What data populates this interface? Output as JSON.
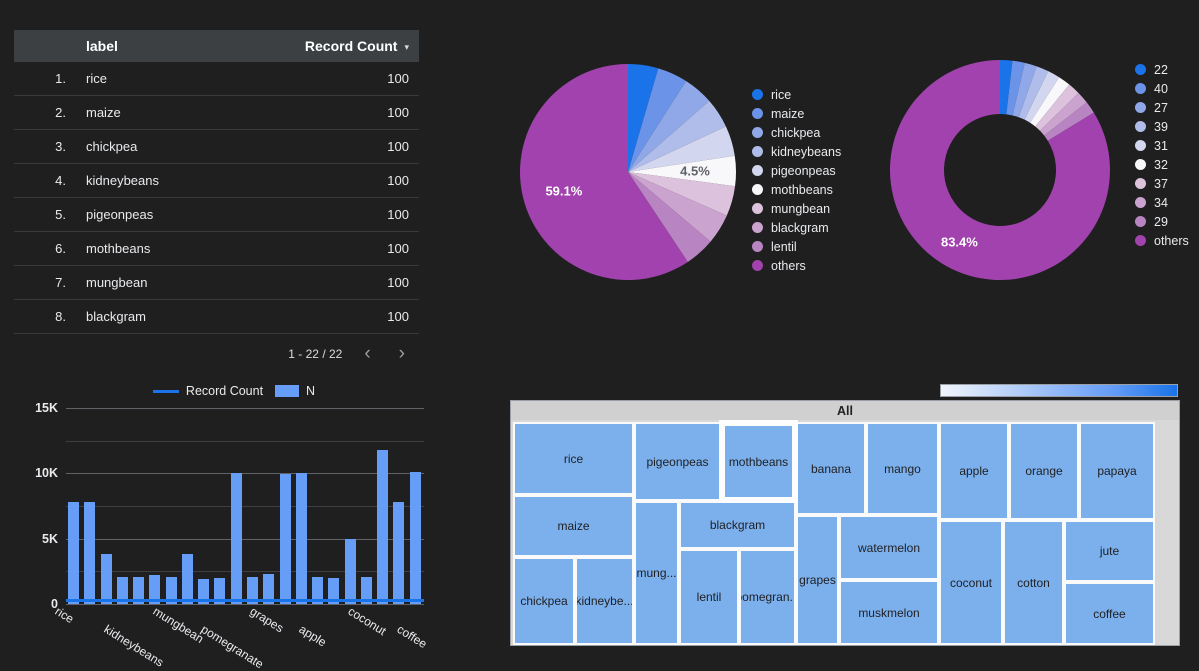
{
  "table": {
    "columns": {
      "index": "",
      "label": "label",
      "count": "Record Count"
    },
    "sort_caret": "▾",
    "rows": [
      {
        "idx": "1.",
        "label": "rice",
        "count": "100"
      },
      {
        "idx": "2.",
        "label": "maize",
        "count": "100"
      },
      {
        "idx": "3.",
        "label": "chickpea",
        "count": "100"
      },
      {
        "idx": "4.",
        "label": "kidneybeans",
        "count": "100"
      },
      {
        "idx": "5.",
        "label": "pigeonpeas",
        "count": "100"
      },
      {
        "idx": "6.",
        "label": "mothbeans",
        "count": "100"
      },
      {
        "idx": "7.",
        "label": "mungbean",
        "count": "100"
      },
      {
        "idx": "8.",
        "label": "blackgram",
        "count": "100"
      }
    ],
    "pager": {
      "range": "1 - 22 / 22",
      "prev": "‹",
      "next": "›"
    }
  },
  "chart_data": [
    {
      "type": "pie",
      "title": "",
      "categories": [
        "rice",
        "maize",
        "chickpea",
        "kidneybeans",
        "pigeonpeas",
        "mothbeans",
        "mungbean",
        "blackgram",
        "lentil",
        "others"
      ],
      "values": [
        4.5,
        4.5,
        4.5,
        4.5,
        4.5,
        4.5,
        4.5,
        4.5,
        4.5,
        59.1
      ],
      "value_unit": "%",
      "labels_shown": {
        "others": "59.1%",
        "mothbeans": "4.5%"
      },
      "colors": [
        "#1a73e8",
        "#6b93e8",
        "#90a8e8",
        "#b0bdea",
        "#d2d6ee",
        "#f8f8fa",
        "#ddc2dd",
        "#cba3cf",
        "#b885c2",
        "#a142ae"
      ],
      "legend_position": "right"
    },
    {
      "type": "pie",
      "variant": "donut",
      "title": "",
      "categories": [
        "22",
        "40",
        "27",
        "39",
        "31",
        "32",
        "37",
        "34",
        "29",
        "others"
      ],
      "values": [
        1.8,
        1.8,
        1.8,
        1.8,
        1.8,
        1.8,
        1.8,
        1.8,
        1.8,
        83.4
      ],
      "value_unit": "%",
      "labels_shown": {
        "others": "83.4%"
      },
      "colors": [
        "#1a73e8",
        "#6b93e8",
        "#90a8e8",
        "#b0bdea",
        "#d2d6ee",
        "#f8f8fa",
        "#ddc2dd",
        "#cba3cf",
        "#b885c2",
        "#a142ae"
      ],
      "legend_position": "right"
    },
    {
      "type": "bar",
      "title": "",
      "xlabel": "",
      "ylabel": "",
      "ylim": [
        0,
        15000
      ],
      "ytick_labels": [
        "0",
        "5K",
        "10K",
        "15K"
      ],
      "ytick_values": [
        0,
        5000,
        10000,
        15000
      ],
      "grid": true,
      "legend_position": "top",
      "legend": [
        {
          "name": "Record Count",
          "marker": "line",
          "color": "#1a73e8"
        },
        {
          "name": "N",
          "marker": "bar",
          "color": "#669df6"
        }
      ],
      "categories": [
        "rice",
        "maize",
        "chickpea",
        "kidneybeans",
        "pigeonpeas",
        "mothbeans",
        "mungbean",
        "blackgram",
        "lentil",
        "pomegranate",
        "banana",
        "mango",
        "grapes",
        "watermelon",
        "muskmelon",
        "apple",
        "orange",
        "papaya",
        "coconut",
        "cotton",
        "jute",
        "coffee"
      ],
      "xtick_labels_shown": [
        "rice",
        "kidneybeans",
        "mungbean",
        "pomegranate",
        "grapes",
        "apple",
        "coconut",
        "coffee"
      ],
      "series": [
        {
          "name": "N",
          "values": [
            7800,
            7800,
            3800,
            2100,
            2100,
            2200,
            2100,
            3800,
            1900,
            2000,
            10000,
            2100,
            2300,
            9950,
            10000,
            2100,
            2000,
            5000,
            2100,
            11800,
            7800,
            10100
          ]
        },
        {
          "name": "Record Count",
          "values": [
            100,
            100,
            100,
            100,
            100,
            100,
            100,
            100,
            100,
            100,
            100,
            100,
            100,
            100,
            100,
            100,
            100,
            100,
            100,
            100,
            100,
            100
          ]
        }
      ]
    },
    {
      "type": "treemap",
      "title": "All",
      "selected": "mothbeans",
      "color_scale": {
        "low": "#f1f5fb",
        "high": "#1a73e8"
      },
      "cells": [
        {
          "label": "rice"
        },
        {
          "label": "maize"
        },
        {
          "label": "chickpea"
        },
        {
          "label": "kidneybe..."
        },
        {
          "label": "pigeonpeas"
        },
        {
          "label": "mung..."
        },
        {
          "label": "blackgram"
        },
        {
          "label": "lentil"
        },
        {
          "label": "pomegran..."
        },
        {
          "label": "mothbeans"
        },
        {
          "label": "banana"
        },
        {
          "label": "mango"
        },
        {
          "label": "grapes"
        },
        {
          "label": "watermelon"
        },
        {
          "label": "muskmelon"
        },
        {
          "label": "apple"
        },
        {
          "label": "orange"
        },
        {
          "label": "papaya"
        },
        {
          "label": "coconut"
        },
        {
          "label": "cotton"
        },
        {
          "label": "jute"
        },
        {
          "label": "coffee"
        }
      ]
    }
  ]
}
